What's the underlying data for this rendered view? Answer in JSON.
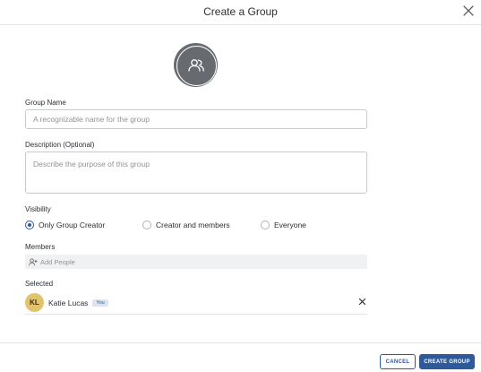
{
  "dialog": {
    "title": "Create a Group"
  },
  "group_icon": "group-people-icon",
  "group_name": {
    "label": "Group Name",
    "placeholder": "A recognizable name for the group",
    "value": ""
  },
  "description": {
    "label": "Description (Optional)",
    "placeholder": "Describe the purpose of this group",
    "value": ""
  },
  "visibility": {
    "label": "Visibility",
    "options": [
      "Only Group Creator",
      "Creator and members",
      "Everyone"
    ],
    "selected": "Only Group Creator"
  },
  "members": {
    "label": "Members",
    "placeholder": "Add People"
  },
  "selected": {
    "label": "Selected",
    "people": [
      {
        "initials": "KL",
        "name": "Katie Lucas",
        "badge": "You"
      }
    ]
  },
  "footer": {
    "cancel_label": "CANCEL",
    "create_label": "CREATE GROUP"
  },
  "colors": {
    "accent": "#2e5a9c",
    "avatar_bg": "#676b70",
    "initials_bg": "#e2c26a"
  }
}
